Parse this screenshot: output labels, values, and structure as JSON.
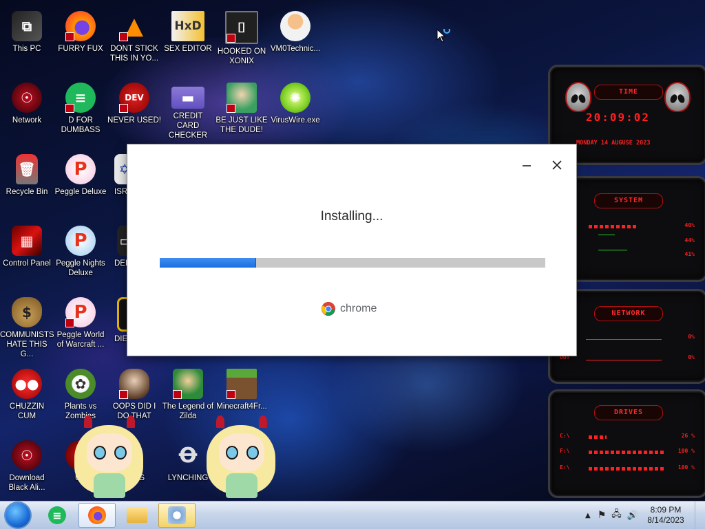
{
  "desktop": {
    "icons": [
      {
        "label": "This PC",
        "icon": "computer-icon"
      },
      {
        "label": "FURRY FUX",
        "icon": "firefox-icon"
      },
      {
        "label": "DONT STICK THIS IN YO...",
        "icon": "traffic-cone-icon"
      },
      {
        "label": "SEX EDITOR",
        "icon": "hxd-icon"
      },
      {
        "label": "HOOKED ON XONIX",
        "icon": "maze-icon"
      },
      {
        "label": "VM0Technic...",
        "icon": "doctor-icon"
      },
      {
        "label": "Network",
        "icon": "alien-head-icon"
      },
      {
        "label": "D FOR DUMBASS",
        "icon": "discord-icon"
      },
      {
        "label": "NEVER USED!",
        "icon": "devcpp-icon"
      },
      {
        "label": "CREDIT CARD CHECKER",
        "icon": "credit-card-icon"
      },
      {
        "label": "BE JUST LIKE THE DUDE!",
        "icon": "santa-icon"
      },
      {
        "label": "VirusWire.exe",
        "icon": "lime-icon"
      },
      {
        "label": "Recycle Bin",
        "icon": "recycle-bin-icon"
      },
      {
        "label": "Peggle Deluxe",
        "icon": "peggle-icon"
      },
      {
        "label": "ISRA",
        "icon": "israel-icon"
      },
      {
        "label": "Control Panel",
        "icon": "control-panel-icon"
      },
      {
        "label": "Peggle Nights Deluxe",
        "icon": "peggle-icon"
      },
      {
        "label": "DEE",
        "icon": "monitor-icon"
      },
      {
        "label": "COMMUNISTS HATE THIS G...",
        "icon": "money-bag-icon"
      },
      {
        "label": "Peggle World of Warcraft ...",
        "icon": "peggle-icon"
      },
      {
        "label": "DIE",
        "icon": "frame-icon"
      },
      {
        "label": "CHUZZIN CUM",
        "icon": "chuzzle-icon"
      },
      {
        "label": "Plants vs Zombies",
        "icon": "flower-icon"
      },
      {
        "label": "OOPS DID I DO THAT",
        "icon": "portrait-icon"
      },
      {
        "label": "The Legend of Zilda",
        "icon": "link-icon"
      },
      {
        "label": "Minecraft4Fr...",
        "icon": "grass-block-icon"
      },
      {
        "label": "Download Black Ali...",
        "icon": "alien-head-icon"
      },
      {
        "label": "UK",
        "icon": "red-orb-icon"
      },
      {
        "label": "PS",
        "icon": "mascot-icon"
      },
      {
        "label": "LYNCHING",
        "icon": "noose-icon"
      }
    ]
  },
  "dialog": {
    "status": "Installing...",
    "progress": 0.25,
    "brand": "chrome",
    "minimize_icon": "minimize-icon",
    "close_icon": "close-icon"
  },
  "gadget": {
    "time_title": "TIME",
    "time": "20:09:02",
    "date": "MONDAY 14 AUGUSE 2023",
    "system_title": "SYSTEM",
    "system_rows": [
      {
        "key": "U",
        "value": "40%"
      },
      {
        "key": "AM",
        "value": "44%"
      },
      {
        "key": "WAP",
        "value": "41%"
      }
    ],
    "network_title": "NETWORK",
    "network_rows": [
      {
        "key": "",
        "value": "0%"
      },
      {
        "key": "OUT",
        "value": "0%"
      }
    ],
    "drives_title": "DRIVES",
    "drive_rows": [
      {
        "key": "C:\\",
        "value": "26 %"
      },
      {
        "key": "F:\\",
        "value": "100 %"
      },
      {
        "key": "E:\\",
        "value": "100 %"
      }
    ]
  },
  "taskbar": {
    "clock_time": "8:09 PM",
    "clock_date": "8/14/2023",
    "pinned": [
      "discord-icon",
      "firefox-icon",
      "folder-icon",
      "installer-icon"
    ]
  },
  "colors": {
    "progress_fill": "#1a6fdf",
    "gadget_red": "#ff1f1f",
    "taskbar": "#c8d6ea"
  }
}
